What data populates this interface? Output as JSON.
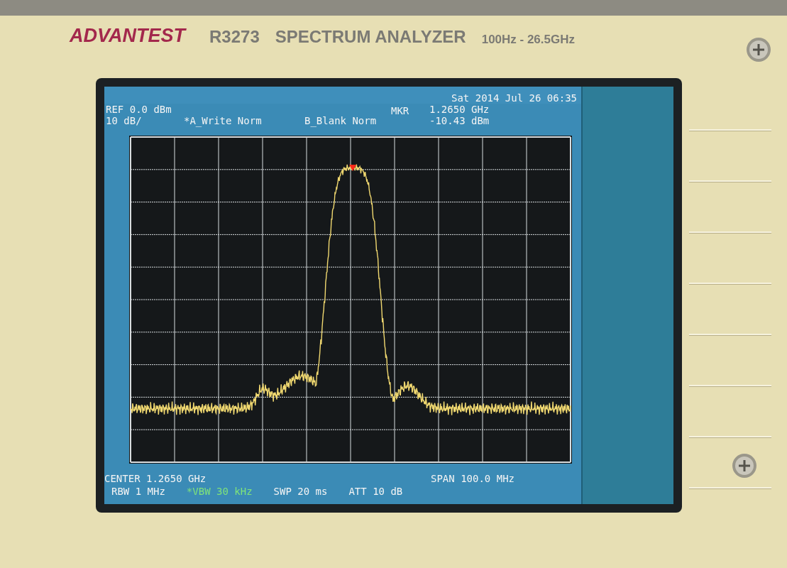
{
  "panel": {
    "brand": "ADVANTEST",
    "model": "R3273",
    "product": "SPECTRUM ANALYZER",
    "range": "100Hz - 26.5GHz"
  },
  "screen": {
    "datetime": "Sat 2014 Jul 26 06:35",
    "header": {
      "ref": "REF 0.0 dBm",
      "scale": "10 dB/",
      "trace_a": "*A_Write Norm",
      "trace_b": "B_Blank Norm",
      "marker_label": "MKR",
      "marker_freq": "1.2650 GHz",
      "marker_level": "-10.43 dBm"
    },
    "footer": {
      "center": "CENTER 1.2650 GHz",
      "span": "SPAN 100.0 MHz",
      "settings": [
        {
          "text": "RBW 1 MHz",
          "highlighted": false
        },
        {
          "text": "*VBW 30 kHz",
          "highlighted": true
        },
        {
          "text": "SWP 20 ms",
          "highlighted": false
        },
        {
          "text": "ATT 10 dB",
          "highlighted": false
        }
      ]
    }
  }
}
